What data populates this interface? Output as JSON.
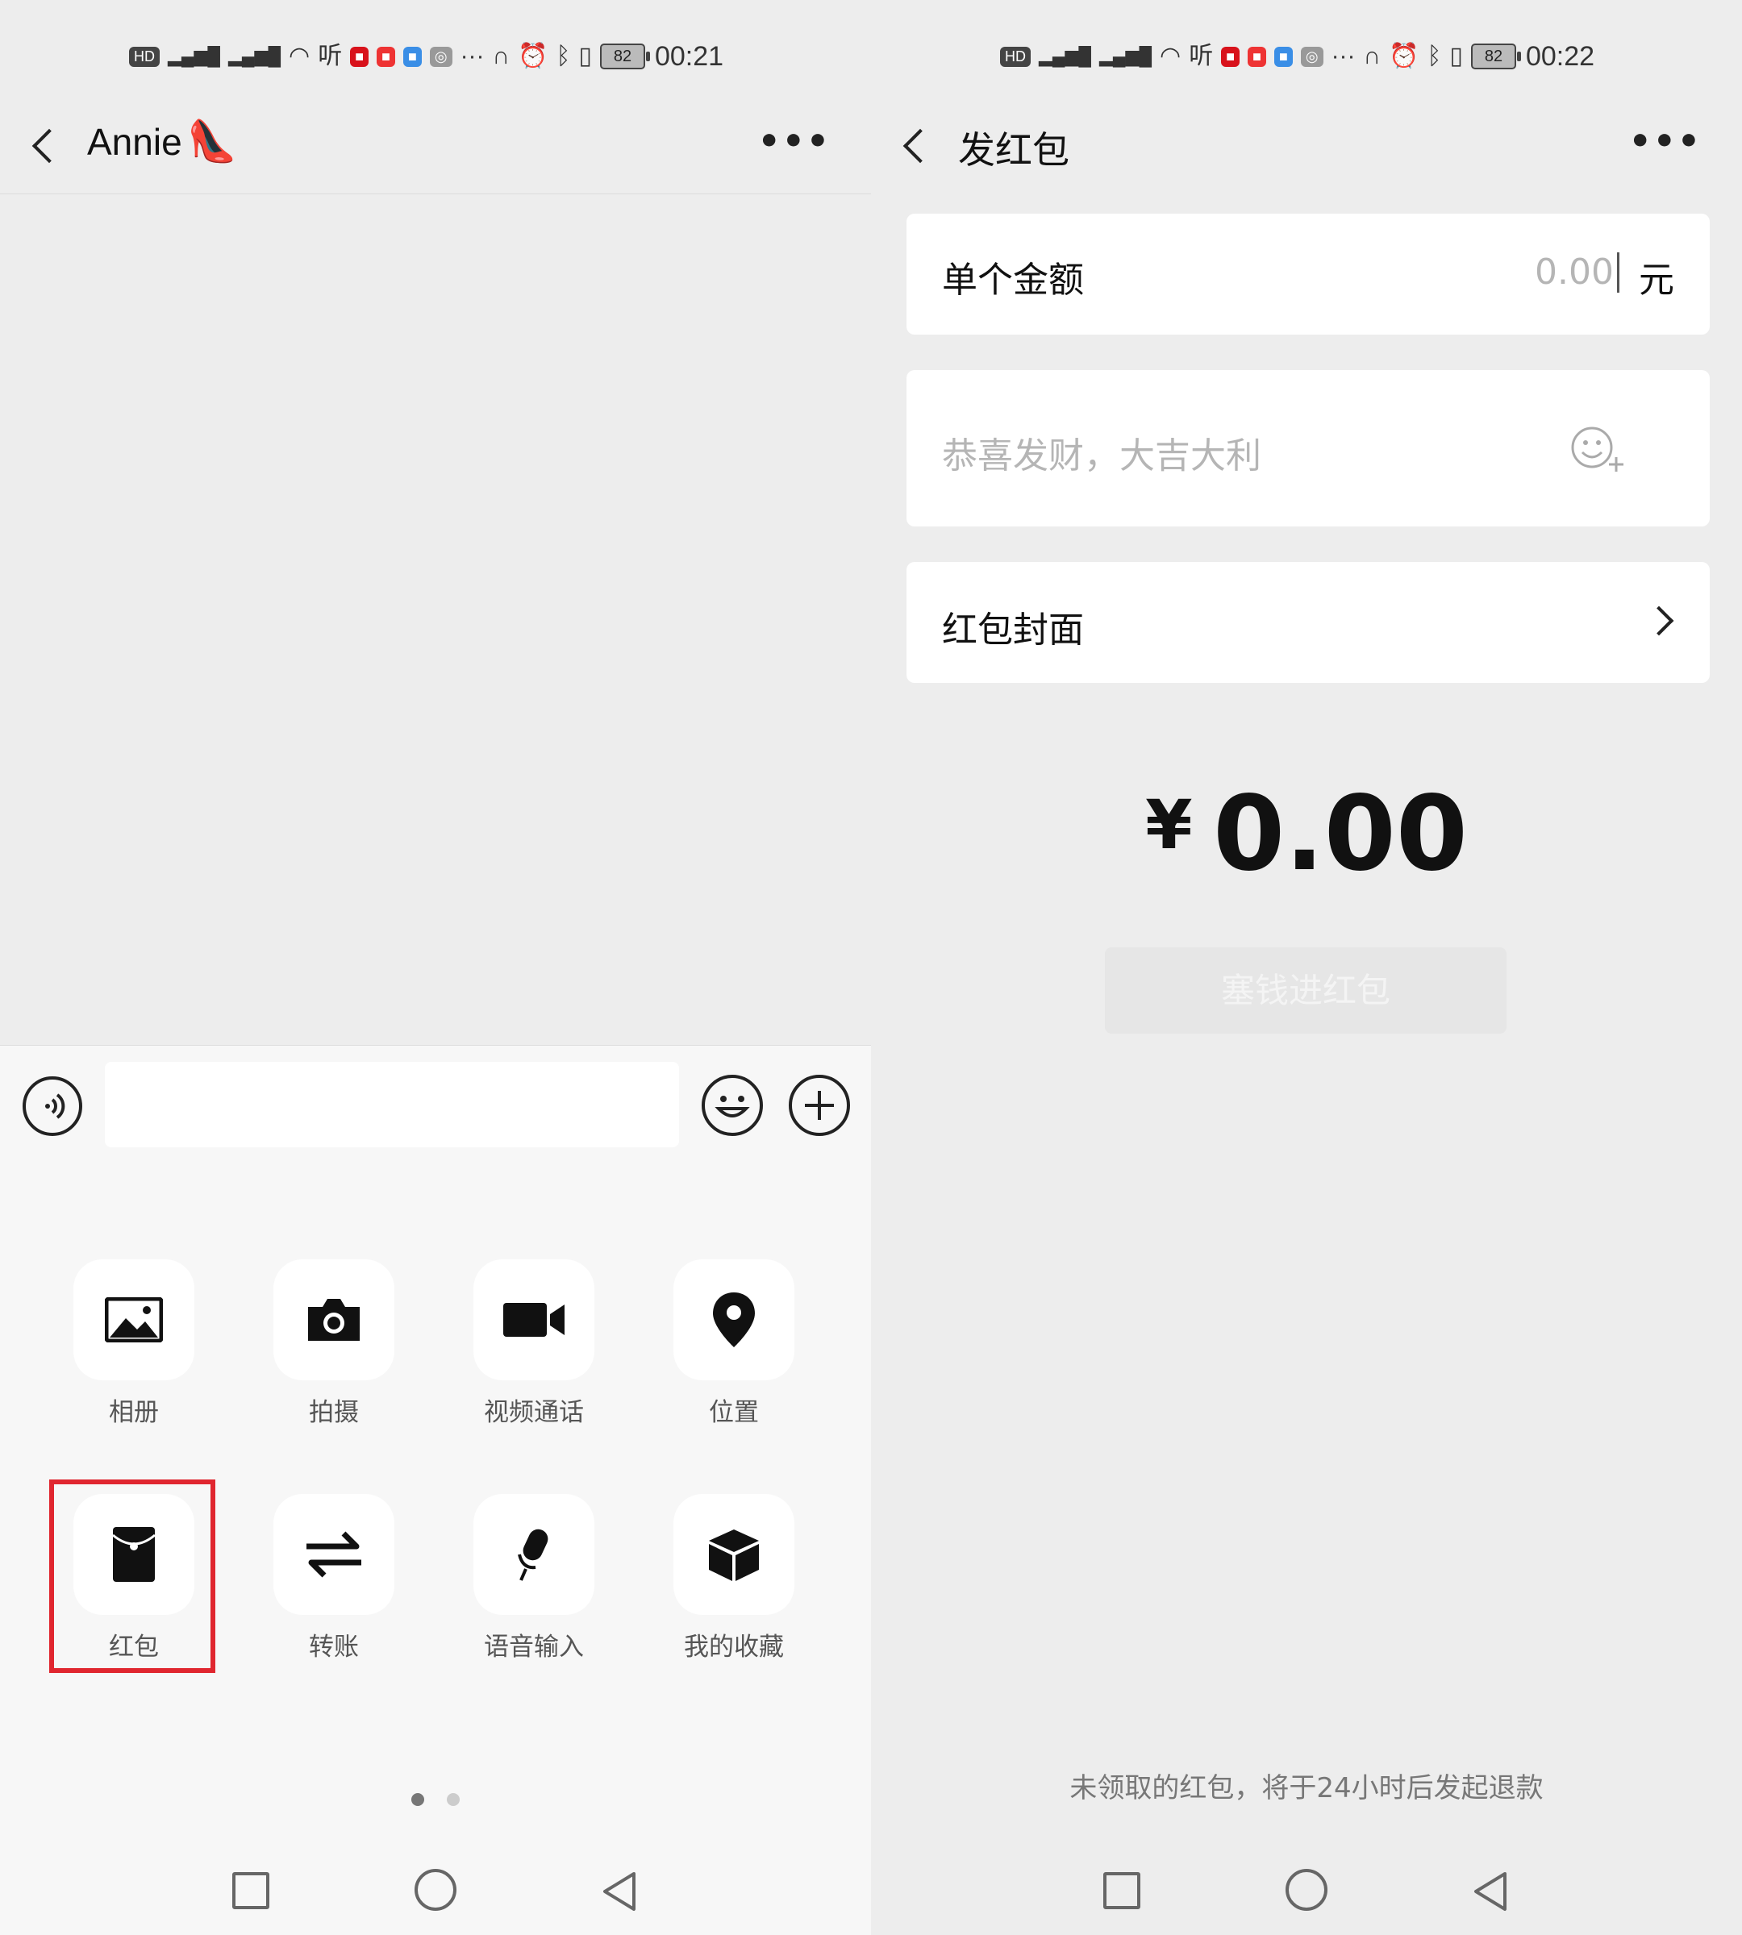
{
  "left": {
    "status": {
      "time": "00:21",
      "battery": "82",
      "badges": [
        "HD",
        "4G",
        "4G",
        "听"
      ]
    },
    "header": {
      "contact": "Annie",
      "contact_emoji": "👠",
      "more": "•••"
    },
    "panel": {
      "items": [
        {
          "label": "相册",
          "icon": "photo-album-icon"
        },
        {
          "label": "拍摄",
          "icon": "camera-icon"
        },
        {
          "label": "视频通话",
          "icon": "video-call-icon"
        },
        {
          "label": "位置",
          "icon": "location-pin-icon"
        },
        {
          "label": "红包",
          "icon": "red-packet-icon",
          "highlighted": true
        },
        {
          "label": "转账",
          "icon": "transfer-icon"
        },
        {
          "label": "语音输入",
          "icon": "microphone-icon"
        },
        {
          "label": "我的收藏",
          "icon": "favorites-box-icon"
        }
      ],
      "page_dots": {
        "count": 2,
        "active": 0
      }
    },
    "highlight_color": "#e0262f"
  },
  "right": {
    "status": {
      "time": "00:22",
      "battery": "82",
      "badges": [
        "HD",
        "4G",
        "4G",
        "听"
      ]
    },
    "header": {
      "title": "发红包",
      "more": "•••"
    },
    "amount_row": {
      "label": "单个金额",
      "placeholder": "0.00",
      "unit": "元"
    },
    "greeting": {
      "placeholder": "恭喜发财，大吉大利"
    },
    "cover_row": {
      "label": "红包封面"
    },
    "total": {
      "currency": "¥",
      "amount": "0.00"
    },
    "submit_button": "塞钱进红包",
    "footer_note": "未领取的红包，将于24小时后发起退款"
  }
}
